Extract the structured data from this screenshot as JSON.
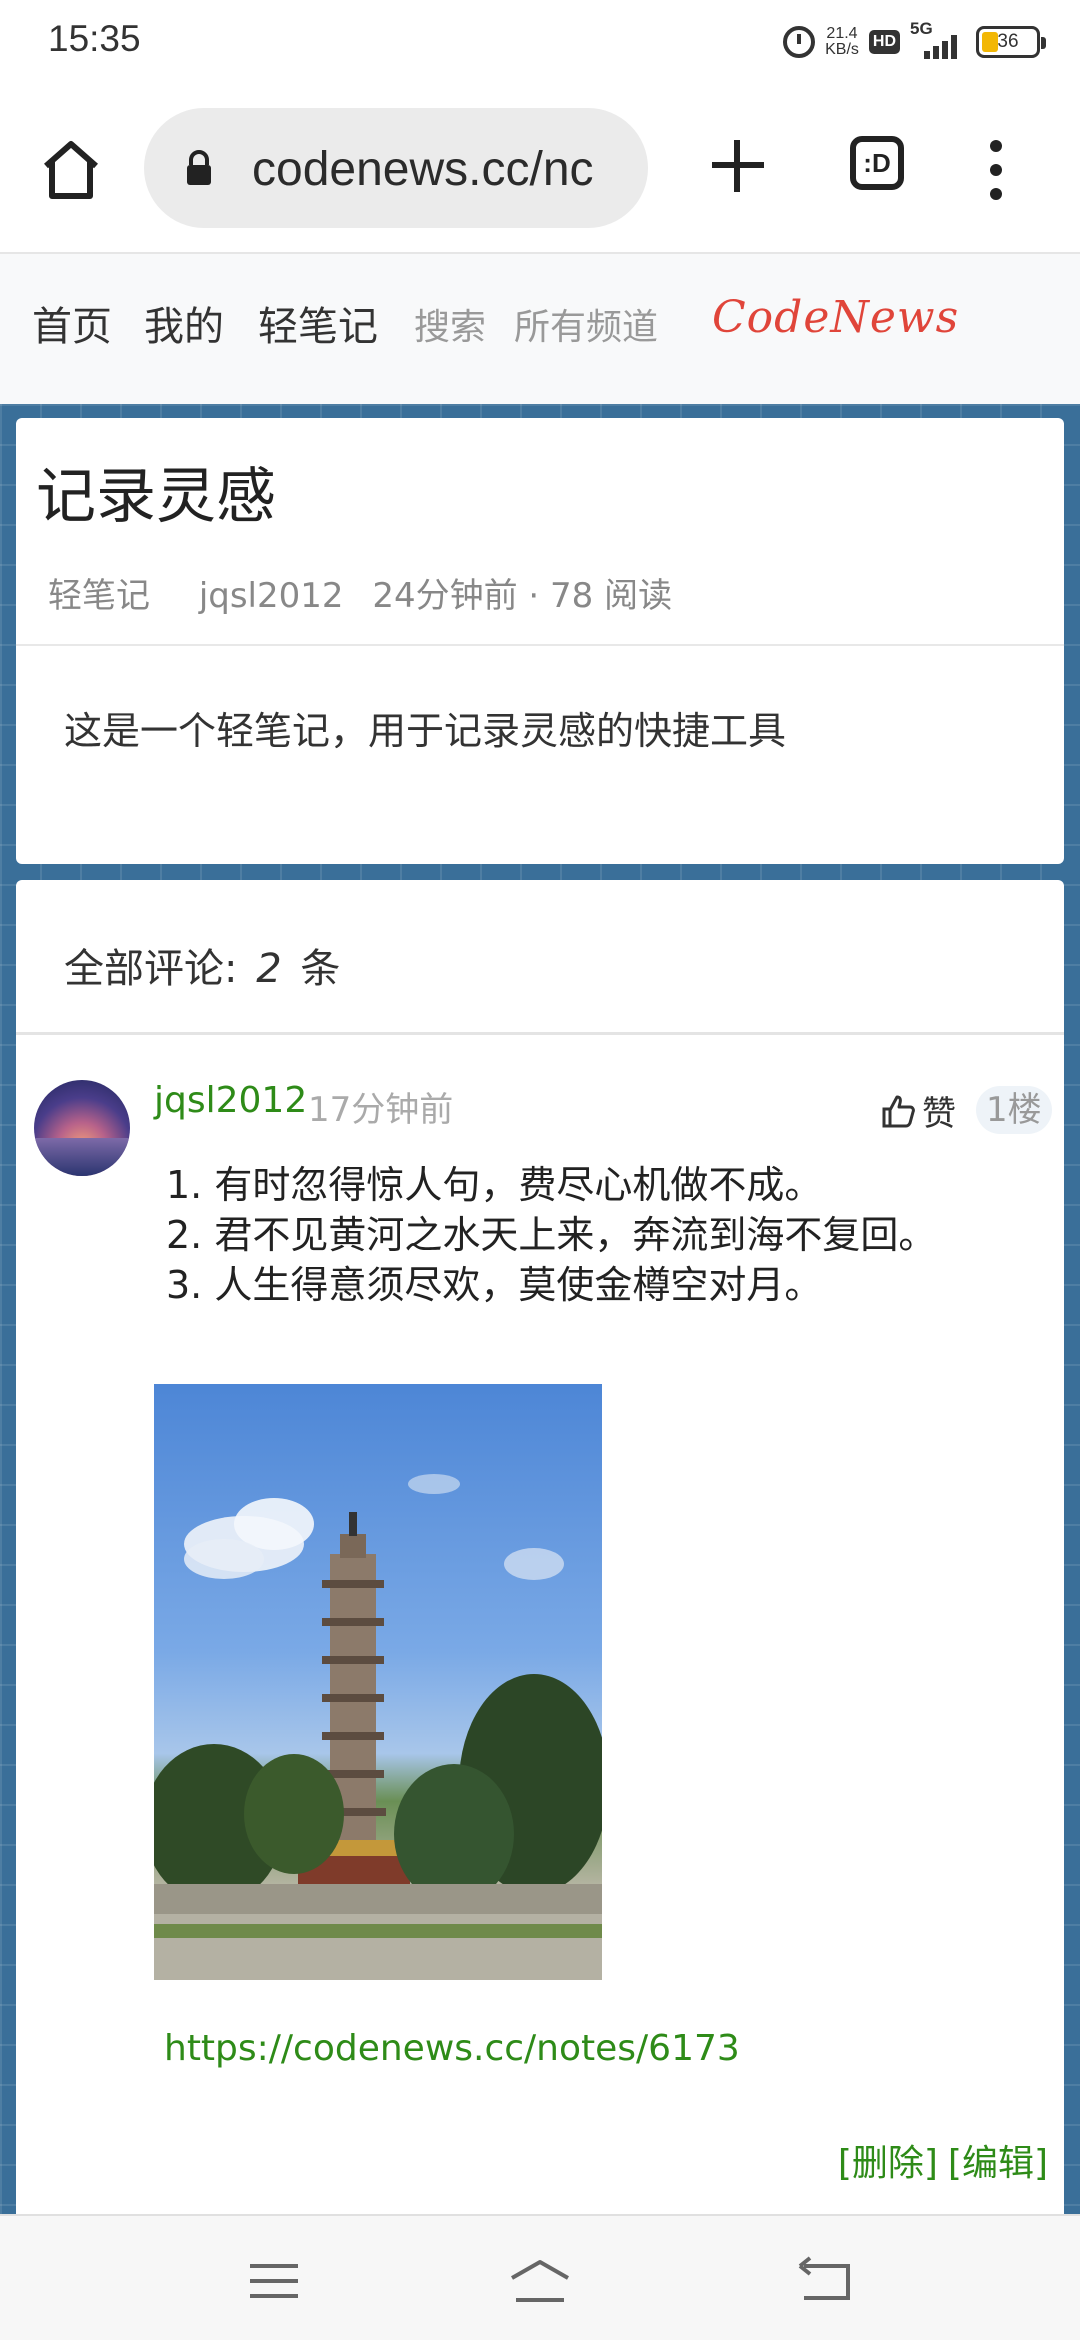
{
  "status_bar": {
    "time": "15:35",
    "net_speed_value": "21.4",
    "net_speed_unit": "KB/s",
    "hd_label": "HD",
    "network_type": "5G",
    "battery": "36",
    "icons": [
      "alarm-icon",
      "hd-icon",
      "signal-icon",
      "battery-icon"
    ]
  },
  "browser": {
    "url": "codenews.cc/nc",
    "tabs_label": ":D",
    "icons": [
      "home-icon",
      "lock-icon",
      "plus-icon",
      "tabs-icon",
      "more-vert-icon"
    ]
  },
  "site_nav": {
    "items": [
      "首页",
      "我的",
      "轻笔记"
    ],
    "dim_items": [
      "搜索",
      "所有频道"
    ],
    "brand": "CodeNews"
  },
  "post": {
    "title": "记录灵感",
    "category": "轻笔记",
    "author": "jqsl2012",
    "time_and_reads": "24分钟前 · 78 阅读",
    "body": "这是一个轻笔记，用于记录灵感的快捷工具"
  },
  "comments": {
    "label_prefix": "全部评论:",
    "count": "2",
    "label_suffix": "条",
    "items": [
      {
        "author": "jqsl2012",
        "time": "17分钟前",
        "like_label": "赞",
        "floor": "1楼",
        "lines": [
          "1. 有时忽得惊人句，费尽心机做不成。",
          "2. 君不见黄河之水天上来，奔流到海不复回。",
          "3. 人生得意须尽欢，莫使金樽空对月。"
        ],
        "link": "https://codenews.cc/notes/6173",
        "delete_label": "[删除]",
        "edit_label": "[编辑]"
      }
    ]
  },
  "colors": {
    "accent_green": "#2e8b18",
    "brand_red": "#e0453a",
    "page_bg_blue": "#3a6f99"
  },
  "bottom_nav": {
    "icons": [
      "menu-lines-icon",
      "home-outline-icon",
      "back-icon"
    ]
  }
}
